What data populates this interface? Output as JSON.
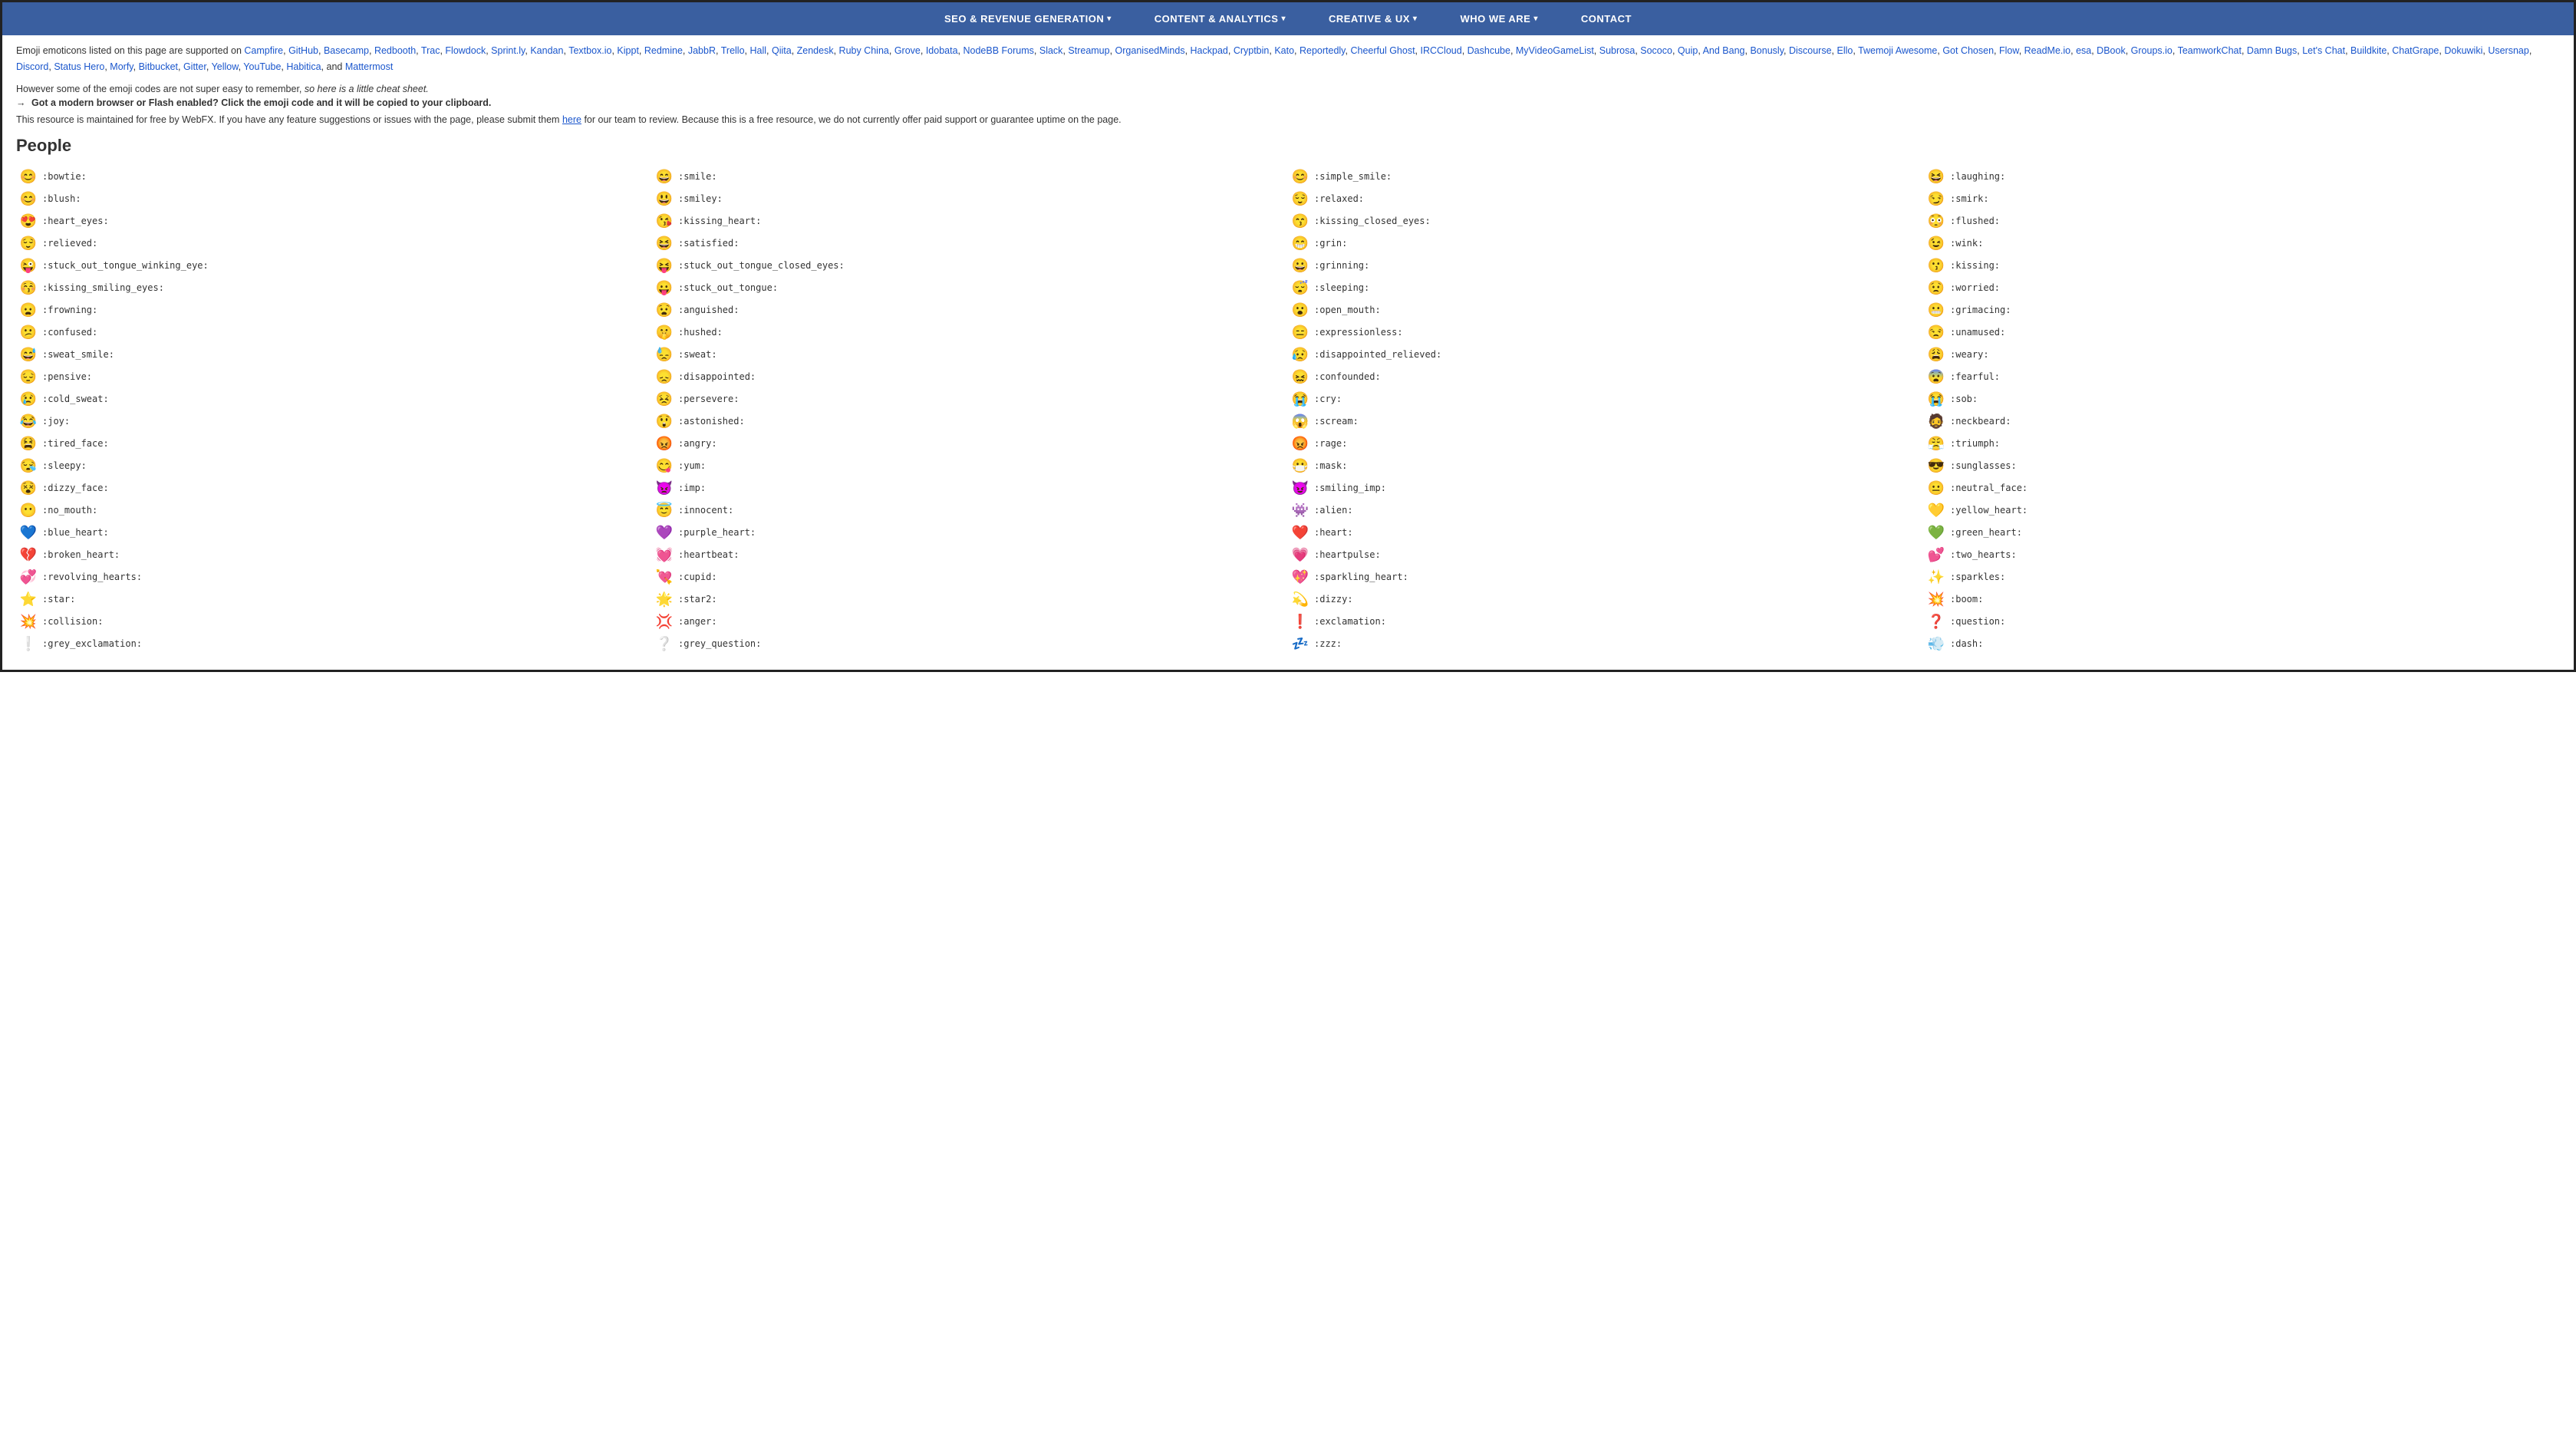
{
  "nav": {
    "items": [
      {
        "label": "SEO & REVENUE GENERATION",
        "hasDropdown": true
      },
      {
        "label": "CONTENT & ANALYTICS",
        "hasDropdown": true
      },
      {
        "label": "CREATIVE & UX",
        "hasDropdown": true
      },
      {
        "label": "WHO WE ARE",
        "hasDropdown": true
      },
      {
        "label": "CONTACT",
        "hasDropdown": false
      }
    ]
  },
  "intro": {
    "prefix": "Emoji emoticons listed on this page are supported on ",
    "links": [
      "Campfire",
      "GitHub",
      "Basecamp",
      "Redbooth",
      "Trac",
      "Flowdock",
      "Sprint.ly",
      "Kandan",
      "Textbox.io",
      "Kippt",
      "Redmine",
      "JabbR",
      "Trello",
      "Hall",
      "Qiita",
      "Zendesk",
      "Ruby China",
      "Grove",
      "Idobata",
      "NodeBB Forums",
      "Slack",
      "Streamup",
      "OrganisedMinds",
      "Hackpad",
      "Cryptbin",
      "Kato",
      "Reportedly",
      "Cheerful Ghost",
      "IRCCloud",
      "Dashcube",
      "MyVideoGameList",
      "Subrosa",
      "Sococo",
      "Quip",
      "And Bang",
      "Bonusly",
      "Discourse",
      "Ello",
      "Twemoji Awesome",
      "Got Chosen",
      "Flow",
      "ReadMe.io",
      "esa",
      "DBook",
      "Groups.io",
      "TeamworkChat",
      "Damn Bugs",
      "Let's Chat",
      "Buildkite",
      "ChatGrape",
      "Dokuwiki",
      "Usersnap",
      "Discord",
      "Status Hero",
      "Morfy",
      "Bitbucket",
      "Gitter",
      "Yellow",
      "YouTube",
      "Habitica",
      "and",
      "Mattermost"
    ],
    "note": "However some of the emoji codes are not super easy to remember,",
    "note_italic": "so here is a little cheat sheet.",
    "click_note": "→ Got a modern browser or Flash enabled? Click the emoji code and it will be copied to your clipboard.",
    "resource": "This resource is maintained for free by WebFX. If you have any feature suggestions or issues with the page, please submit them",
    "resource_link": "here",
    "resource_suffix": "for our team to review. Because this is a free resource, we do not currently offer paid support or guarantee uptime on the page."
  },
  "section": {
    "title": "People"
  },
  "emojis": [
    {
      "icon": "😊",
      "code": ":bowtie:"
    },
    {
      "icon": "😄",
      "code": ":smile:"
    },
    {
      "icon": "😊",
      "code": ":simple_smile:"
    },
    {
      "icon": "😆",
      "code": ":laughing:"
    },
    {
      "icon": "😊",
      "code": ":blush:"
    },
    {
      "icon": "😃",
      "code": ":smiley:"
    },
    {
      "icon": "😌",
      "code": ":relaxed:"
    },
    {
      "icon": "😏",
      "code": ":smirk:"
    },
    {
      "icon": "😍",
      "code": ":heart_eyes:"
    },
    {
      "icon": "😘",
      "code": ":kissing_heart:"
    },
    {
      "icon": "😙",
      "code": ":kissing_closed_eyes:"
    },
    {
      "icon": "😳",
      "code": ":flushed:"
    },
    {
      "icon": "😌",
      "code": ":relieved:"
    },
    {
      "icon": "😆",
      "code": ":satisfied:"
    },
    {
      "icon": "😁",
      "code": ":grin:"
    },
    {
      "icon": "😉",
      "code": ":wink:"
    },
    {
      "icon": "😜",
      "code": ":stuck_out_tongue_winking_eye:"
    },
    {
      "icon": "😝",
      "code": ":stuck_out_tongue_closed_eyes:"
    },
    {
      "icon": "😀",
      "code": ":grinning:"
    },
    {
      "icon": "😗",
      "code": ":kissing:"
    },
    {
      "icon": "😚",
      "code": ":kissing_smiling_eyes:"
    },
    {
      "icon": "😛",
      "code": ":stuck_out_tongue:"
    },
    {
      "icon": "😴",
      "code": ":sleeping:"
    },
    {
      "icon": "😟",
      "code": ":worried:"
    },
    {
      "icon": "😦",
      "code": ":frowning:"
    },
    {
      "icon": "😧",
      "code": ":anguished:"
    },
    {
      "icon": "😮",
      "code": ":open_mouth:"
    },
    {
      "icon": "😬",
      "code": ":grimacing:"
    },
    {
      "icon": "😕",
      "code": ":confused:"
    },
    {
      "icon": "🤫",
      "code": ":hushed:"
    },
    {
      "icon": "😑",
      "code": ":expressionless:"
    },
    {
      "icon": "😒",
      "code": ":unamused:"
    },
    {
      "icon": "😅",
      "code": ":sweat_smile:"
    },
    {
      "icon": "😓",
      "code": ":sweat:"
    },
    {
      "icon": "😥",
      "code": ":disappointed_relieved:"
    },
    {
      "icon": "😩",
      "code": ":weary:"
    },
    {
      "icon": "😔",
      "code": ":pensive:"
    },
    {
      "icon": "😞",
      "code": ":disappointed:"
    },
    {
      "icon": "😖",
      "code": ":confounded:"
    },
    {
      "icon": "😨",
      "code": ":fearful:"
    },
    {
      "icon": "😢",
      "code": ":cold_sweat:"
    },
    {
      "icon": "😣",
      "code": ":persevere:"
    },
    {
      "icon": "😭",
      "code": ":cry:"
    },
    {
      "icon": "😭",
      "code": ":sob:"
    },
    {
      "icon": "😂",
      "code": ":joy:"
    },
    {
      "icon": "😲",
      "code": ":astonished:"
    },
    {
      "icon": "😱",
      "code": ":scream:"
    },
    {
      "icon": "🧔",
      "code": ":neckbeard:"
    },
    {
      "icon": "😫",
      "code": ":tired_face:"
    },
    {
      "icon": "😡",
      "code": ":angry:"
    },
    {
      "icon": "😡",
      "code": ":rage:"
    },
    {
      "icon": "😤",
      "code": ":triumph:"
    },
    {
      "icon": "😪",
      "code": ":sleepy:"
    },
    {
      "icon": "😋",
      "code": ":yum:"
    },
    {
      "icon": "😷",
      "code": ":mask:"
    },
    {
      "icon": "😎",
      "code": ":sunglasses:"
    },
    {
      "icon": "😵",
      "code": ":dizzy_face:"
    },
    {
      "icon": "👿",
      "code": ":imp:"
    },
    {
      "icon": "😈",
      "code": ":smiling_imp:"
    },
    {
      "icon": "😐",
      "code": ":neutral_face:"
    },
    {
      "icon": "😶",
      "code": ":no_mouth:"
    },
    {
      "icon": "😇",
      "code": ":innocent:"
    },
    {
      "icon": "👾",
      "code": ":alien:"
    },
    {
      "icon": "💛",
      "code": ":yellow_heart:"
    },
    {
      "icon": "💙",
      "code": ":blue_heart:"
    },
    {
      "icon": "💜",
      "code": ":purple_heart:"
    },
    {
      "icon": "❤️",
      "code": ":heart:"
    },
    {
      "icon": "💚",
      "code": ":green_heart:"
    },
    {
      "icon": "💔",
      "code": ":broken_heart:"
    },
    {
      "icon": "💓",
      "code": ":heartbeat:"
    },
    {
      "icon": "💗",
      "code": ":heartpulse:"
    },
    {
      "icon": "💕",
      "code": ":two_hearts:"
    },
    {
      "icon": "💞",
      "code": ":revolving_hearts:"
    },
    {
      "icon": "💘",
      "code": ":cupid:"
    },
    {
      "icon": "💖",
      "code": ":sparkling_heart:"
    },
    {
      "icon": "✨",
      "code": ":sparkles:"
    },
    {
      "icon": "⭐",
      "code": ":star:"
    },
    {
      "icon": "🌟",
      "code": ":star2:"
    },
    {
      "icon": "💫",
      "code": ":dizzy:"
    },
    {
      "icon": "💥",
      "code": ":boom:"
    },
    {
      "icon": "💥",
      "code": ":collision:"
    },
    {
      "icon": "💢",
      "code": ":anger:"
    },
    {
      "icon": "❗",
      "code": ":exclamation:"
    },
    {
      "icon": "❓",
      "code": ":question:"
    },
    {
      "icon": "❕",
      "code": ":grey_exclamation:"
    },
    {
      "icon": "❔",
      "code": ":grey_question:"
    },
    {
      "icon": "💤",
      "code": ":zzz:"
    },
    {
      "icon": "💨",
      "code": ":dash:"
    }
  ]
}
